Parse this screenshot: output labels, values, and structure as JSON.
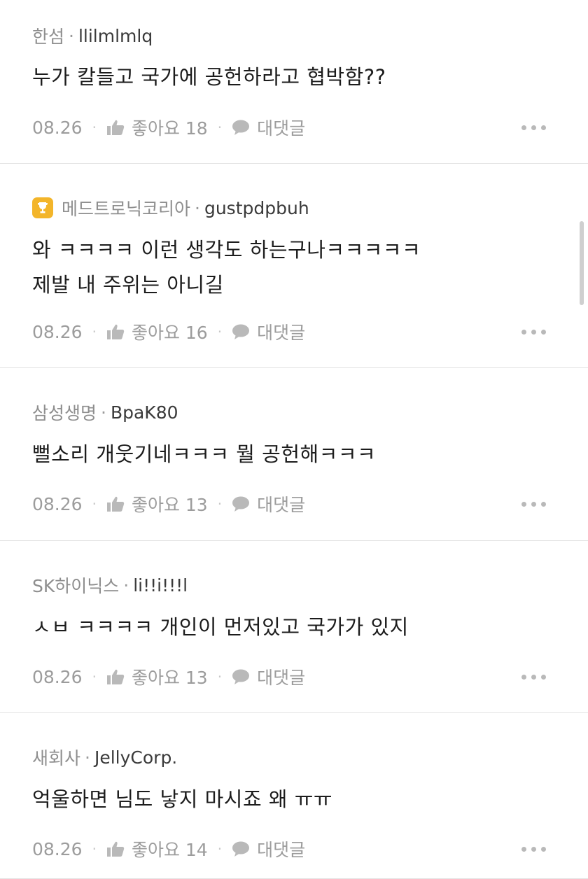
{
  "comments": [
    {
      "company": "한섬",
      "nickname": "llilmlmlq",
      "has_badge": false,
      "lines": [
        "누가 칼들고 국가에 공헌하라고 협박함??"
      ],
      "date": "08.26",
      "like_label": "좋아요 18",
      "reply_label": "대댓글"
    },
    {
      "company": "메드트로닉코리아",
      "nickname": "gustpdpbuh",
      "has_badge": true,
      "lines": [
        "와 ㅋㅋㅋㅋ 이런 생각도 하는구나ㅋㅋㅋㅋㅋ",
        "제발 내 주위는 아니길"
      ],
      "date": "08.26",
      "like_label": "좋아요 16",
      "reply_label": "대댓글"
    },
    {
      "company": "삼성생명",
      "nickname": "BpaK80",
      "has_badge": false,
      "lines": [
        "뻘소리 개웃기네ㅋㅋㅋ 뭘 공헌해ㅋㅋㅋ"
      ],
      "date": "08.26",
      "like_label": "좋아요 13",
      "reply_label": "대댓글"
    },
    {
      "company": "SK하이닉스",
      "nickname": "li!!i!!!l",
      "has_badge": false,
      "lines": [
        "ㅅㅂ ㅋㅋㅋㅋ 개인이 먼저있고 국가가 있지"
      ],
      "date": "08.26",
      "like_label": "좋아요 13",
      "reply_label": "대댓글"
    },
    {
      "company": "새회사",
      "nickname": "JellyCorp.",
      "has_badge": false,
      "lines": [
        "억울하면 님도 낳지 마시죠 왜 ㅠㅠ"
      ],
      "date": "08.26",
      "like_label": "좋아요 14",
      "reply_label": "대댓글"
    }
  ],
  "icons": {
    "like": "thumbs-up-icon",
    "reply": "speech-bubble-icon",
    "more": "more-dots-icon",
    "badge": "trophy-icon"
  },
  "colors": {
    "meta": "#8e8e8e",
    "text": "#1c1c1c",
    "badge": "#f3b52a",
    "divider": "#e3e3e3"
  }
}
